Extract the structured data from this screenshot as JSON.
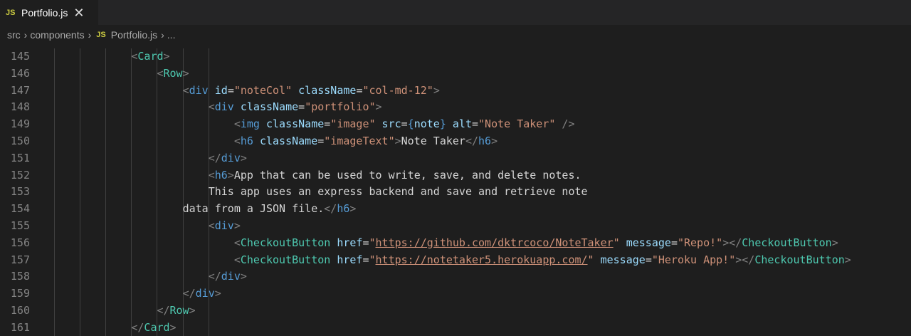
{
  "tab": {
    "badge": "JS",
    "title": "Portfolio.js",
    "close": "✕"
  },
  "breadcrumbs": {
    "segments": [
      "src",
      "components"
    ],
    "file_badge": "JS",
    "file": "Portfolio.js",
    "tail": "..."
  },
  "editor": {
    "lines": [
      {
        "n": "145",
        "indent": 3,
        "tokens": [
          [
            "punc",
            "<"
          ],
          [
            "comp",
            "Card"
          ],
          [
            "punc",
            ">"
          ]
        ]
      },
      {
        "n": "146",
        "indent": 4,
        "tokens": [
          [
            "punc",
            "<"
          ],
          [
            "comp",
            "Row"
          ],
          [
            "punc",
            ">"
          ]
        ]
      },
      {
        "n": "147",
        "indent": 5,
        "tokens": [
          [
            "punc",
            "<"
          ],
          [
            "tag",
            "div"
          ],
          [
            "txt",
            " "
          ],
          [
            "attr",
            "id"
          ],
          [
            "op",
            "="
          ],
          [
            "str",
            "\"noteCol\""
          ],
          [
            "txt",
            " "
          ],
          [
            "attr",
            "className"
          ],
          [
            "op",
            "="
          ],
          [
            "str",
            "\"col-md-12\""
          ],
          [
            "punc",
            ">"
          ]
        ]
      },
      {
        "n": "148",
        "indent": 6,
        "tokens": [
          [
            "punc",
            "<"
          ],
          [
            "tag",
            "div"
          ],
          [
            "txt",
            " "
          ],
          [
            "attr",
            "className"
          ],
          [
            "op",
            "="
          ],
          [
            "str",
            "\"portfolio\""
          ],
          [
            "punc",
            ">"
          ]
        ]
      },
      {
        "n": "149",
        "indent": 7,
        "tokens": [
          [
            "punc",
            "<"
          ],
          [
            "tag",
            "img"
          ],
          [
            "txt",
            " "
          ],
          [
            "attr",
            "className"
          ],
          [
            "op",
            "="
          ],
          [
            "str",
            "\"image\""
          ],
          [
            "txt",
            " "
          ],
          [
            "attr",
            "src"
          ],
          [
            "op",
            "="
          ],
          [
            "brace",
            "{"
          ],
          [
            "var",
            "note"
          ],
          [
            "brace",
            "}"
          ],
          [
            "txt",
            " "
          ],
          [
            "attr",
            "alt"
          ],
          [
            "op",
            "="
          ],
          [
            "str",
            "\"Note Taker\""
          ],
          [
            "txt",
            " "
          ],
          [
            "punc",
            "/>"
          ]
        ]
      },
      {
        "n": "150",
        "indent": 7,
        "tokens": [
          [
            "punc",
            "<"
          ],
          [
            "tag",
            "h6"
          ],
          [
            "txt",
            " "
          ],
          [
            "attr",
            "className"
          ],
          [
            "op",
            "="
          ],
          [
            "str",
            "\"imageText\""
          ],
          [
            "punc",
            ">"
          ],
          [
            "txt",
            "Note Taker"
          ],
          [
            "punc",
            "</"
          ],
          [
            "tag",
            "h6"
          ],
          [
            "punc",
            ">"
          ]
        ]
      },
      {
        "n": "151",
        "indent": 6,
        "tokens": [
          [
            "punc",
            "</"
          ],
          [
            "tag",
            "div"
          ],
          [
            "punc",
            ">"
          ]
        ]
      },
      {
        "n": "152",
        "indent": 6,
        "tokens": [
          [
            "punc",
            "<"
          ],
          [
            "tag",
            "h6"
          ],
          [
            "punc",
            ">"
          ],
          [
            "txt",
            "App that can be used to write, save, and delete notes."
          ]
        ]
      },
      {
        "n": "153",
        "indent": 6,
        "tokens": [
          [
            "txt",
            "This app uses an express backend and save and retrieve note"
          ]
        ]
      },
      {
        "n": "154",
        "indent": 5,
        "tokens": [
          [
            "txt",
            "data from a JSON file."
          ],
          [
            "punc",
            "</"
          ],
          [
            "tag",
            "h6"
          ],
          [
            "punc",
            ">"
          ]
        ]
      },
      {
        "n": "155",
        "indent": 6,
        "tokens": [
          [
            "punc",
            "<"
          ],
          [
            "tag",
            "div"
          ],
          [
            "punc",
            ">"
          ]
        ]
      },
      {
        "n": "156",
        "indent": 7,
        "tokens": [
          [
            "punc",
            "<"
          ],
          [
            "comp",
            "CheckoutButton"
          ],
          [
            "txt",
            " "
          ],
          [
            "attr",
            "href"
          ],
          [
            "op",
            "="
          ],
          [
            "str",
            "\""
          ],
          [
            "url",
            "https://github.com/dktrcoco/NoteTaker"
          ],
          [
            "str",
            "\""
          ],
          [
            "txt",
            " "
          ],
          [
            "attr",
            "message"
          ],
          [
            "op",
            "="
          ],
          [
            "str",
            "\"Repo!\""
          ],
          [
            "punc",
            "></"
          ],
          [
            "comp",
            "CheckoutButton"
          ],
          [
            "punc",
            ">"
          ]
        ]
      },
      {
        "n": "157",
        "indent": 7,
        "tokens": [
          [
            "punc",
            "<"
          ],
          [
            "comp",
            "CheckoutButton"
          ],
          [
            "txt",
            " "
          ],
          [
            "attr",
            "href"
          ],
          [
            "op",
            "="
          ],
          [
            "str",
            "\""
          ],
          [
            "url",
            "https://notetaker5.herokuapp.com/"
          ],
          [
            "str",
            "\""
          ],
          [
            "txt",
            " "
          ],
          [
            "attr",
            "message"
          ],
          [
            "op",
            "="
          ],
          [
            "str",
            "\"Heroku App!\""
          ],
          [
            "punc",
            "></"
          ],
          [
            "comp",
            "CheckoutButton"
          ],
          [
            "punc",
            ">"
          ]
        ]
      },
      {
        "n": "158",
        "indent": 6,
        "tokens": [
          [
            "punc",
            "</"
          ],
          [
            "tag",
            "div"
          ],
          [
            "punc",
            ">"
          ]
        ]
      },
      {
        "n": "159",
        "indent": 5,
        "tokens": [
          [
            "punc",
            "</"
          ],
          [
            "tag",
            "div"
          ],
          [
            "punc",
            ">"
          ]
        ]
      },
      {
        "n": "160",
        "indent": 4,
        "tokens": [
          [
            "punc",
            "</"
          ],
          [
            "comp",
            "Row"
          ],
          [
            "punc",
            ">"
          ]
        ]
      },
      {
        "n": "161",
        "indent": 3,
        "tokens": [
          [
            "punc",
            "</"
          ],
          [
            "comp",
            "Card"
          ],
          [
            "punc",
            ">"
          ]
        ]
      }
    ]
  },
  "colors": {
    "background": "#1e1e1e",
    "tag": "#569cd6",
    "component": "#4ec9b0",
    "attribute": "#9cdcfe",
    "string": "#ce9178",
    "js_badge": "#cbcb41"
  }
}
